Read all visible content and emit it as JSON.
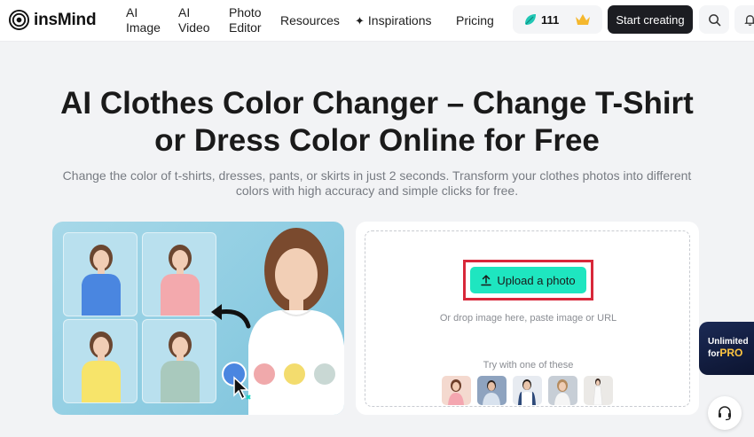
{
  "header": {
    "logo_text": "insMind",
    "nav": [
      {
        "label_line1": "AI",
        "label_line2": "Image"
      },
      {
        "label_line1": "AI",
        "label_line2": "Video"
      },
      {
        "label_line1": "Photo",
        "label_line2": "Editor"
      },
      {
        "label": "Resources"
      },
      {
        "label": "Inspirations",
        "icon": "sparkle-icon"
      },
      {
        "label": "Pricing"
      }
    ],
    "credits": "111",
    "start_label": "Start creating"
  },
  "hero": {
    "title_line1": "AI Clothes Color Changer – Change T-Shirt",
    "title_line2": "or Dress Color Online for Free",
    "subtitle_line1": "Change the color of t-shirts, dresses, pants, or skirts in just 2 seconds. Transform your clothes photos into different",
    "subtitle_line2": "colors with high accuracy and simple clicks for free."
  },
  "showcase": {
    "shirt_colors": [
      "#4a86e0",
      "#f3a9ad",
      "#f7e46a",
      "#a9c9bd"
    ],
    "swatches": [
      "#4a86e0",
      "#f0a9ab",
      "#f3dc6e",
      "#c9d8d4"
    ]
  },
  "upload": {
    "button_label": "Upload a photo",
    "hint": "Or drop image here, paste image or URL",
    "try_label": "Try with one of these"
  },
  "pro_badge": {
    "line1": "Unlimited",
    "line2_prefix": "for",
    "line2_pro": "PRO"
  },
  "colors": {
    "accent": "#1ee6c0",
    "highlight": "#d8283a",
    "dark": "#1c1d22"
  }
}
